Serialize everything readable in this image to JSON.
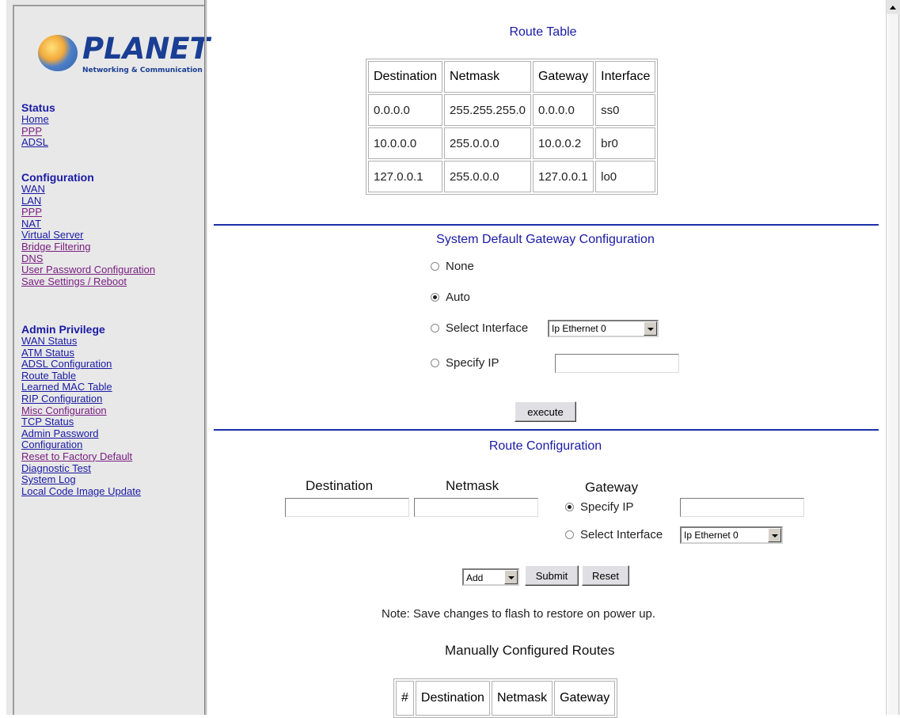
{
  "logo": {
    "brand": "PLANET",
    "tagline": "Networking & Communication"
  },
  "sidebar": {
    "status": {
      "heading": "Status",
      "links": [
        "Home",
        "PPP",
        "ADSL"
      ]
    },
    "configuration": {
      "heading": "Configuration",
      "links": [
        "WAN",
        "LAN",
        "PPP",
        "NAT",
        "Virtual Server",
        "Bridge Filtering",
        "DNS",
        "User Password Configuration",
        "Save Settings / Reboot"
      ]
    },
    "admin": {
      "heading": "Admin Privilege",
      "links": [
        "WAN Status",
        "ATM Status",
        "ADSL Configuration",
        "Route Table",
        "Learned MAC Table",
        "RIP Configuration",
        "Misc Configuration",
        "TCP Status",
        "Admin Password",
        "Configuration",
        "Reset to Factory Default",
        "Diagnostic Test",
        "System Log",
        "Local Code Image Update"
      ]
    }
  },
  "route_table": {
    "title": "Route Table",
    "headers": [
      "Destination",
      "Netmask",
      "Gateway",
      "Interface"
    ],
    "rows": [
      [
        "0.0.0.0",
        "255.255.255.0",
        "0.0.0.0",
        "ss0"
      ],
      [
        "10.0.0.0",
        "255.0.0.0",
        "10.0.0.2",
        "br0"
      ],
      [
        "127.0.0.1",
        "255.0.0.0",
        "127.0.0.1",
        "lo0"
      ]
    ]
  },
  "default_gateway": {
    "title": "System Default Gateway Configuration",
    "options": {
      "none": "None",
      "auto": "Auto",
      "select_interface": "Select Interface",
      "specify_ip": "Specify IP"
    },
    "selected": "auto",
    "interface_value": "Ip Ethernet 0",
    "ip_value": "",
    "execute_label": "execute"
  },
  "route_config": {
    "title": "Route Configuration",
    "destination_label": "Destination",
    "netmask_label": "Netmask",
    "gateway_label": "Gateway",
    "specify_ip": "Specify IP",
    "select_interface": "Select Interface",
    "interface_value": "Ip Ethernet 0",
    "action_value": "Add",
    "submit_label": "Submit",
    "reset_label": "Reset",
    "note": "Note: Save changes to flash to restore on power up."
  },
  "manual_routes": {
    "title": "Manually Configured Routes",
    "headers": [
      "#",
      "Destination",
      "Netmask",
      "Gateway"
    ]
  }
}
